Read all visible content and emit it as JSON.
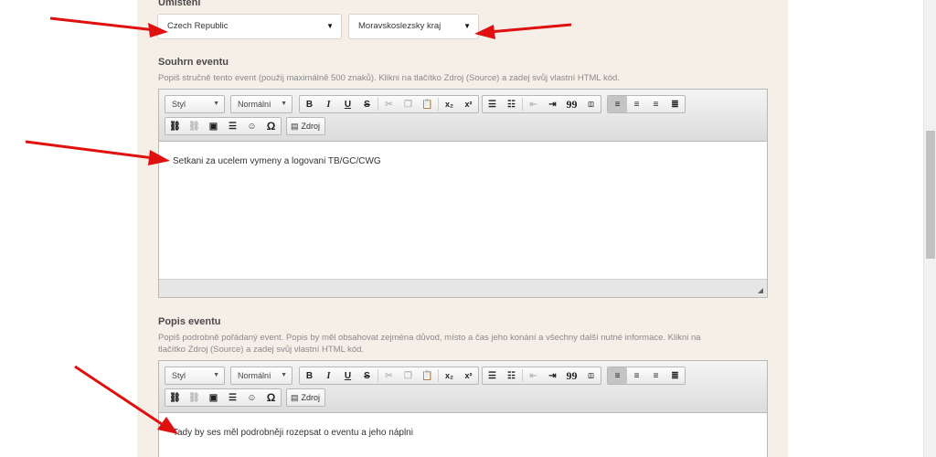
{
  "location": {
    "label": "Umístění",
    "country": "Czech Republic",
    "region": "Moravskoslezsky kraj"
  },
  "summary": {
    "label": "Souhrn eventu",
    "description": "Popiš stručně tento event (použij maximálně 500 znaků). Klikni na tlačítko Zdroj (Source) a zadej svůj vlastní HTML kód.",
    "content": "Setkani za ucelem vymeny a logovani TB/GC/CWG"
  },
  "details": {
    "label": "Popis eventu",
    "description_line1": "Popiš podrobně pořádaný event. Popis by měl obsahovat zejména důvod, místo a čas jeho konání a všechny další nutné informace. Klikni na",
    "description_line2": "tlačítko Zdroj (Source) a zadej svůj vlastní HTML kód.",
    "content": "Tady by ses měl podrobněji rozepsat o eventu a jeho náplni"
  },
  "toolbar": {
    "style_label": "Styl",
    "format_label": "Normální",
    "source_label": "Zdroj",
    "bold": "B",
    "italic": "I",
    "underline": "U",
    "strike": "S",
    "subscript": "x₂",
    "superscript": "x²",
    "blockquote": "99",
    "omega": "Ω"
  },
  "colors": {
    "panel": "#f6efe8",
    "arrow": "#e01010"
  }
}
